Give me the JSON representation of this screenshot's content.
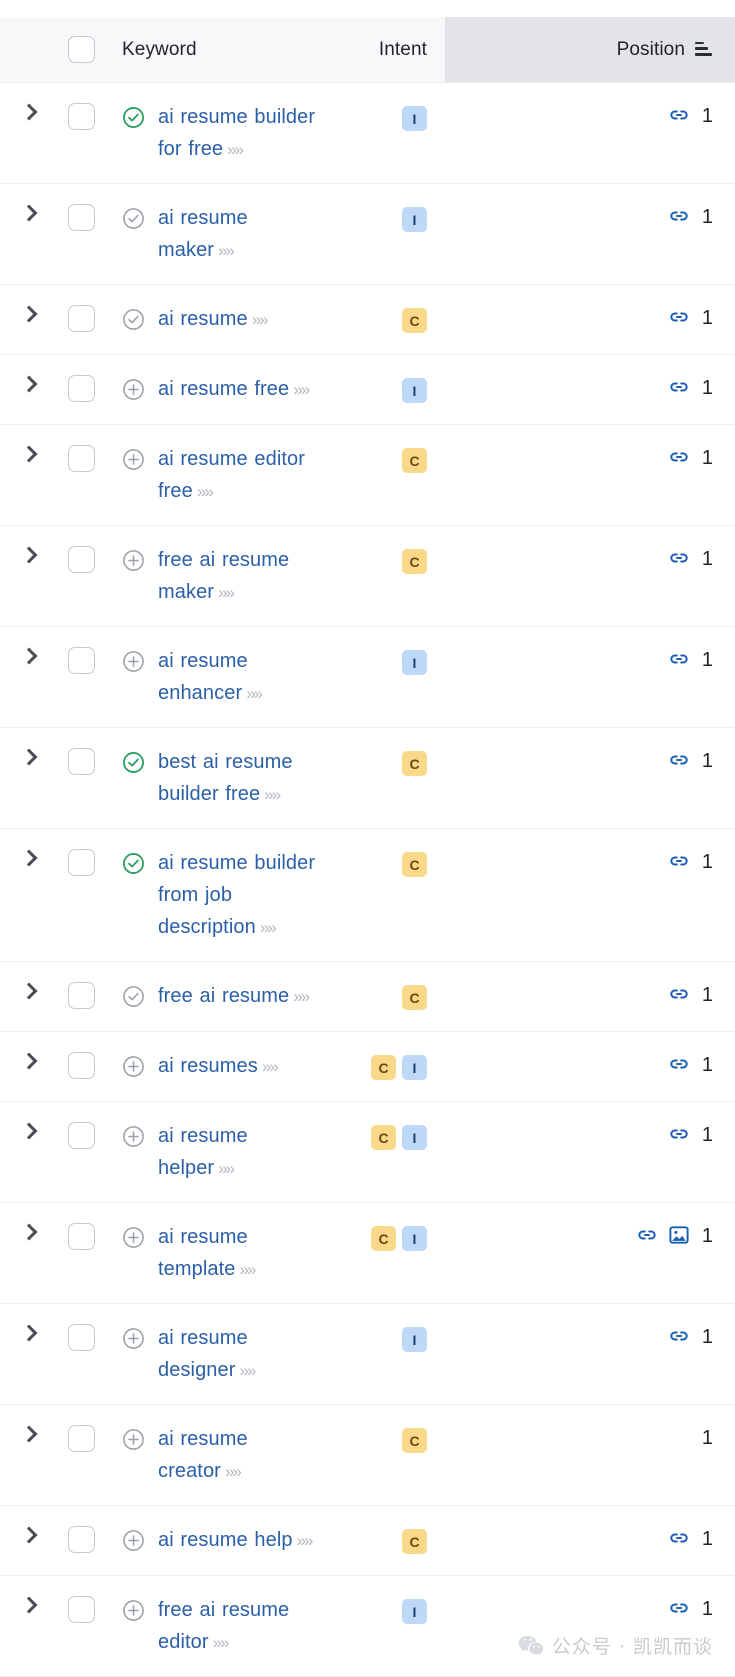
{
  "table": {
    "header": {
      "select_all_checkbox": "",
      "keyword_label": "Keyword",
      "intent_label": "Intent",
      "position_label": "Position",
      "sort_icon": "sort-descending-icon",
      "sorted_column": "Position"
    },
    "icons": {
      "expand": "chevron-right-icon",
      "status_tracked": "check-circle-green-icon",
      "status_checked": "check-circle-gray-icon",
      "status_add": "plus-circle-gray-icon",
      "keyword_link": "double-chevron-right-icon",
      "serp_link": "link-icon",
      "serp_image": "image-icon"
    },
    "colors": {
      "link_blue": "#2b5fa8",
      "icon_blue": "#1a5fb4",
      "badge_informational_bg": "#bdd9f7",
      "badge_informational_fg": "#1c3f73",
      "badge_commercial_bg": "#f8d98a",
      "badge_commercial_fg": "#6b4a12",
      "status_green": "#2e9e61",
      "status_gray": "#9aa0a8",
      "header_bg": "#f7f8fa",
      "sorted_col_bg": "#e2e4e8"
    },
    "arrows_glyph": "»",
    "rows": [
      {
        "keyword": "ai resume builder for free",
        "status": "check-circle-green-icon",
        "intents": [
          "I"
        ],
        "serp_features": [
          "link-icon"
        ],
        "position": "1"
      },
      {
        "keyword": "ai resume maker",
        "status": "check-circle-gray-icon",
        "intents": [
          "I"
        ],
        "serp_features": [
          "link-icon"
        ],
        "position": "1"
      },
      {
        "keyword": "ai resume",
        "status": "check-circle-gray-icon",
        "intents": [
          "C"
        ],
        "serp_features": [
          "link-icon"
        ],
        "position": "1"
      },
      {
        "keyword": "ai resume free",
        "status": "plus-circle-gray-icon",
        "intents": [
          "I"
        ],
        "serp_features": [
          "link-icon"
        ],
        "position": "1"
      },
      {
        "keyword": "ai resume editor free",
        "status": "plus-circle-gray-icon",
        "intents": [
          "C"
        ],
        "serp_features": [
          "link-icon"
        ],
        "position": "1"
      },
      {
        "keyword": "free ai resume maker",
        "status": "plus-circle-gray-icon",
        "intents": [
          "C"
        ],
        "serp_features": [
          "link-icon"
        ],
        "position": "1"
      },
      {
        "keyword": "ai resume enhancer",
        "status": "plus-circle-gray-icon",
        "intents": [
          "I"
        ],
        "serp_features": [
          "link-icon"
        ],
        "position": "1"
      },
      {
        "keyword": "best ai resume builder free",
        "status": "check-circle-green-icon",
        "intents": [
          "C"
        ],
        "serp_features": [
          "link-icon"
        ],
        "position": "1"
      },
      {
        "keyword": "ai resume builder from job description",
        "status": "check-circle-green-icon",
        "intents": [
          "C"
        ],
        "serp_features": [
          "link-icon"
        ],
        "position": "1"
      },
      {
        "keyword": "free ai resume",
        "status": "check-circle-gray-icon",
        "intents": [
          "C"
        ],
        "serp_features": [
          "link-icon"
        ],
        "position": "1"
      },
      {
        "keyword": "ai resumes",
        "status": "plus-circle-gray-icon",
        "intents": [
          "C",
          "I"
        ],
        "serp_features": [
          "link-icon"
        ],
        "position": "1"
      },
      {
        "keyword": "ai resume helper",
        "status": "plus-circle-gray-icon",
        "intents": [
          "C",
          "I"
        ],
        "serp_features": [
          "link-icon"
        ],
        "position": "1"
      },
      {
        "keyword": "ai resume template",
        "status": "plus-circle-gray-icon",
        "intents": [
          "C",
          "I"
        ],
        "serp_features": [
          "link-icon",
          "image-icon"
        ],
        "position": "1"
      },
      {
        "keyword": "ai resume designer",
        "status": "plus-circle-gray-icon",
        "intents": [
          "I"
        ],
        "serp_features": [
          "link-icon"
        ],
        "position": "1"
      },
      {
        "keyword": "ai resume creator",
        "status": "plus-circle-gray-icon",
        "intents": [
          "C"
        ],
        "serp_features": [],
        "position": "1"
      },
      {
        "keyword": "ai resume help",
        "status": "plus-circle-gray-icon",
        "intents": [
          "C"
        ],
        "serp_features": [
          "link-icon"
        ],
        "position": "1"
      },
      {
        "keyword": "free ai resume editor",
        "status": "plus-circle-gray-icon",
        "intents": [
          "I"
        ],
        "serp_features": [
          "link-icon"
        ],
        "position": "1"
      }
    ]
  },
  "watermark": {
    "logo": "wechat-icon",
    "text": "公众号 · 凯凯而谈"
  }
}
